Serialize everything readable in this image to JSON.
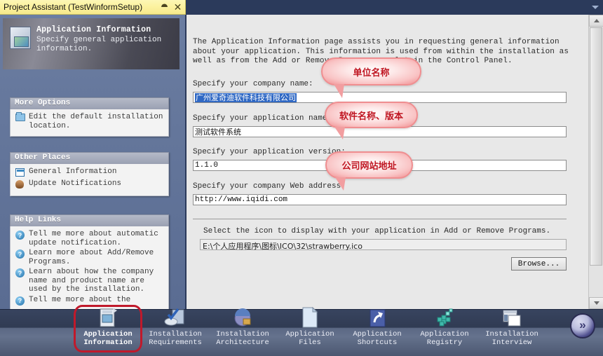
{
  "window": {
    "title": "Project Assistant (TestWinformSetup)",
    "pin_icon": "pin-icon",
    "close_icon": "close-icon"
  },
  "header": {
    "title": "Application Information",
    "subtitle": "Specify general application information.",
    "icon": "application-information-icon"
  },
  "sidebar": {
    "groups": [
      {
        "title": "More Options",
        "items": [
          {
            "icon": "folder-icon",
            "label": "Edit the default installation location."
          }
        ]
      },
      {
        "title": "Other Places",
        "items": [
          {
            "icon": "calendar-icon",
            "label": "General Information"
          },
          {
            "icon": "person-icon",
            "label": "Update Notifications"
          }
        ]
      },
      {
        "title": "Help Links",
        "items": [
          {
            "icon": "help-icon",
            "label": "Tell me more about automatic update notification."
          },
          {
            "icon": "help-icon",
            "label": "Learn more about Add/Remove Programs."
          },
          {
            "icon": "help-icon",
            "label": "Learn about how the company name and product name are used by the installation."
          },
          {
            "icon": "help-icon",
            "label": "Tell me more about the"
          }
        ]
      }
    ]
  },
  "main": {
    "intro": "The Application Information page assists you in requesting general information about your application. This information is used from within the installation as well as from the Add or Remove Programs applet in the Control Panel.",
    "fields": [
      {
        "label": "Specify your company name:",
        "value": "广州爱奇迪软件科技有限公司",
        "selected": true
      },
      {
        "label": "Specify your application name:",
        "value": "测试软件系统",
        "selected": false
      },
      {
        "label": "Specify your application version:",
        "value": "1.1.0",
        "selected": false
      },
      {
        "label": "Specify your company Web address:",
        "value": "http://www.iqidi.com",
        "selected": false
      }
    ],
    "icon_section": {
      "hint": "Select the icon to display with your application in Add or Remove Programs.",
      "path": "E:\\个人应用程序\\图标\\ICO\\32\\strawberry.ico",
      "browse_label": "Browse..."
    }
  },
  "callouts": [
    {
      "text": "单位名称",
      "color": "#c01622"
    },
    {
      "text": "软件名称、版本",
      "color": "#c01622"
    },
    {
      "text": "公司网站地址",
      "color": "#c01622"
    }
  ],
  "taskbar": {
    "home_icon": "home-icon",
    "back_icon": "back-arrow-icon",
    "forward_icon": "forward-arrow-icon",
    "items": [
      {
        "label_line1": "Application",
        "label_line2": "Information",
        "icon": "application-information-icon",
        "active": true
      },
      {
        "label_line1": "Installation",
        "label_line2": "Requirements",
        "icon": "installation-requirements-icon",
        "active": false
      },
      {
        "label_line1": "Installation",
        "label_line2": "Architecture",
        "icon": "installation-architecture-icon",
        "active": false
      },
      {
        "label_line1": "Application",
        "label_line2": "Files",
        "icon": "application-files-icon",
        "active": false
      },
      {
        "label_line1": "Application",
        "label_line2": "Shortcuts",
        "icon": "application-shortcuts-icon",
        "active": false
      },
      {
        "label_line1": "Application",
        "label_line2": "Registry",
        "icon": "application-registry-icon",
        "active": false
      },
      {
        "label_line1": "Installation",
        "label_line2": "Interview",
        "icon": "installation-interview-icon",
        "active": false
      }
    ]
  },
  "scrollbar": {
    "up_icon": "scroll-up-arrow",
    "down_icon": "scroll-down-arrow"
  }
}
